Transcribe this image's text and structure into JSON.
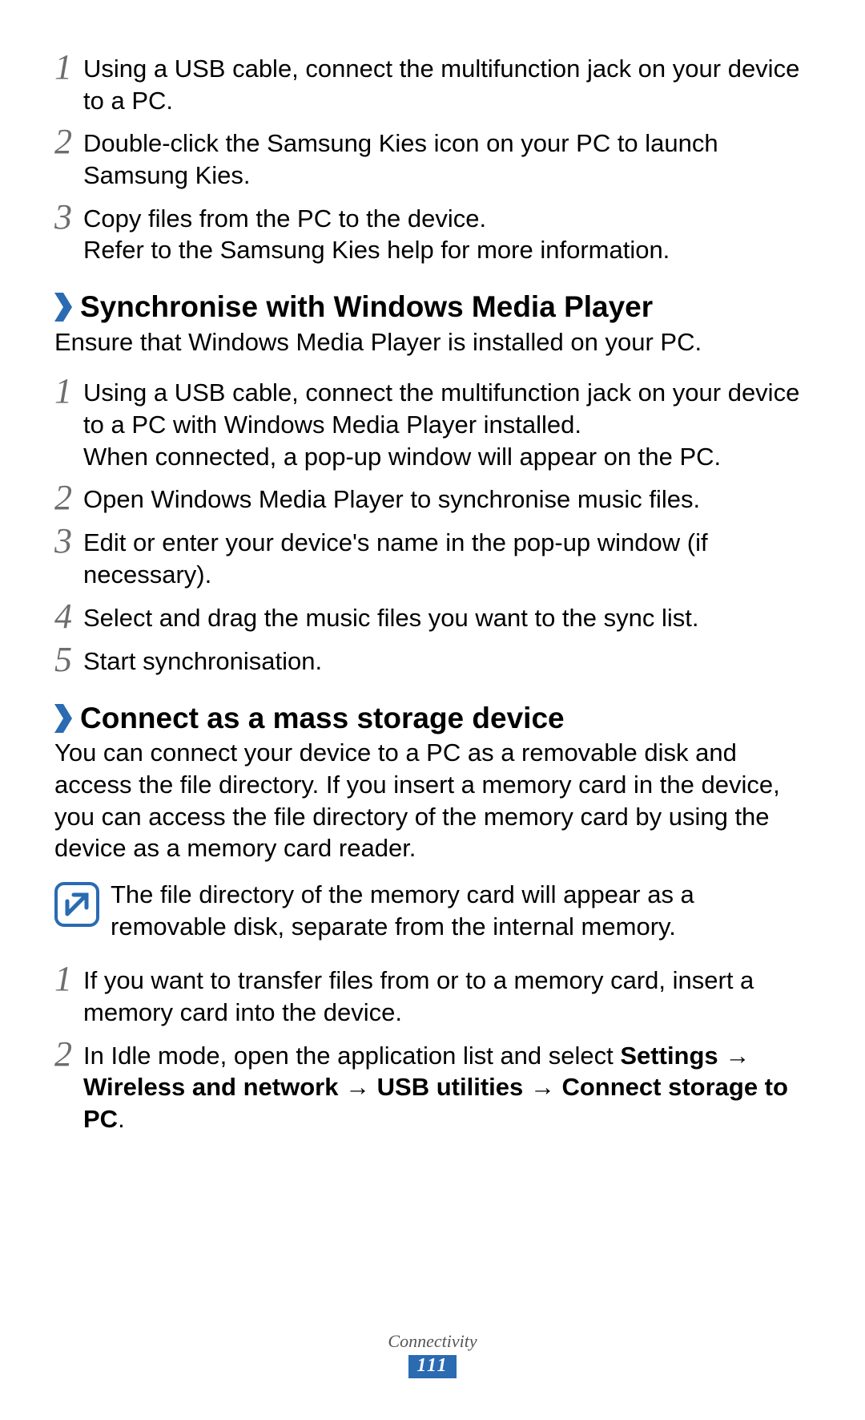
{
  "top_steps": [
    {
      "num": "1",
      "text": "Using a USB cable, connect the multifunction jack on your device to a PC."
    },
    {
      "num": "2",
      "text": "Double-click the Samsung Kies icon on your PC to launch Samsung Kies."
    },
    {
      "num": "3",
      "text": "Copy files from the PC to the device.\nRefer to the Samsung Kies help for more information."
    }
  ],
  "section1": {
    "heading": "Synchronise with Windows Media Player",
    "intro": "Ensure that Windows Media Player is installed on your PC.",
    "steps": [
      {
        "num": "1",
        "text": "Using a USB cable, connect the multifunction jack on your device to a PC with Windows Media Player installed.\nWhen connected, a pop-up window will appear on the PC."
      },
      {
        "num": "2",
        "text": "Open Windows Media Player to synchronise music files."
      },
      {
        "num": "3",
        "text": "Edit or enter your device's name in the pop-up window (if necessary)."
      },
      {
        "num": "4",
        "text": "Select and drag the music files you want to the sync list."
      },
      {
        "num": "5",
        "text": "Start synchronisation."
      }
    ]
  },
  "section2": {
    "heading": "Connect as a mass storage device",
    "intro": "You can connect your device to a PC as a removable disk and access the file directory. If you insert a memory card in the device, you can access the file directory of the memory card by using the device as a memory card reader.",
    "note": "The file directory of the memory card will appear as a removable disk, separate from the internal memory.",
    "steps": [
      {
        "num": "1",
        "text": "If you want to transfer files from or to a memory card, insert a memory card into the device."
      },
      {
        "num": "2",
        "prefix": "In Idle mode, open the application list and select ",
        "bold": "Settings → Wireless and network → USB utilities → Connect storage to PC",
        "suffix": "."
      }
    ]
  },
  "footer": {
    "label": "Connectivity",
    "page": "111"
  }
}
